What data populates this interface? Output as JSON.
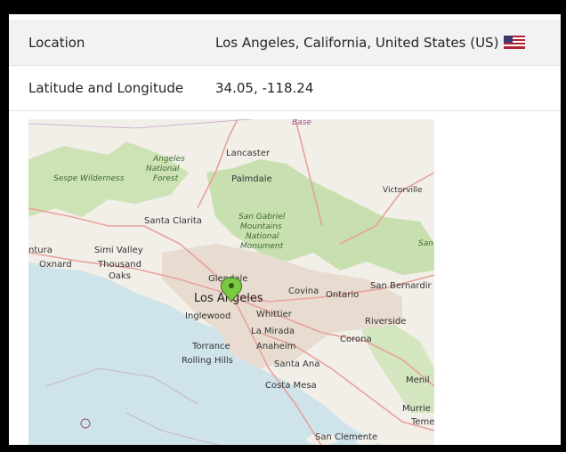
{
  "details": {
    "location_label": "Location",
    "location_value": "Los Angeles, California, United States (US)",
    "latlong_label": "Latitude and Longitude",
    "latlong_value": "34.05, -118.24"
  },
  "map": {
    "labels": {
      "base": "Base",
      "lancaster": "Lancaster",
      "angeles_nf": "Angeles National Forest",
      "sespe": "Sespe Wilderness",
      "palmdale": "Palmdale",
      "victorville": "Victorville",
      "santa_clarita": "Santa Clarita",
      "san_gabriel": "San Gabriel Mountains National Monument",
      "ventura": "ntura",
      "simi_valley": "Simi Valley",
      "oxnard": "Oxnard",
      "thousand_oaks": "Thousand Oaks",
      "glendale": "Glendale",
      "los_angeles": "Los Angeles",
      "covina": "Covina",
      "ontario": "Ontario",
      "san_bernardino": "San Bernardir",
      "inglewood": "Inglewood",
      "whittier": "Whittier",
      "riverside": "Riverside",
      "la_mirada": "La Mirada",
      "corona": "Corona",
      "torrance": "Torrance",
      "anaheim": "Anaheim",
      "rolling_hills": "Rolling Hills",
      "santa_ana": "Santa Ana",
      "costa_mesa": "Costa Mesa",
      "menil": "Menil",
      "murrie": "Murrie",
      "teme": "Teme",
      "san_clemente": "San Clemente",
      "san": "San"
    },
    "marker": "location-pin",
    "colors": {
      "water": "#d6e9ed",
      "land": "#f2efe9",
      "forest": "#c8dfb0",
      "marker": "#7ac943"
    }
  }
}
